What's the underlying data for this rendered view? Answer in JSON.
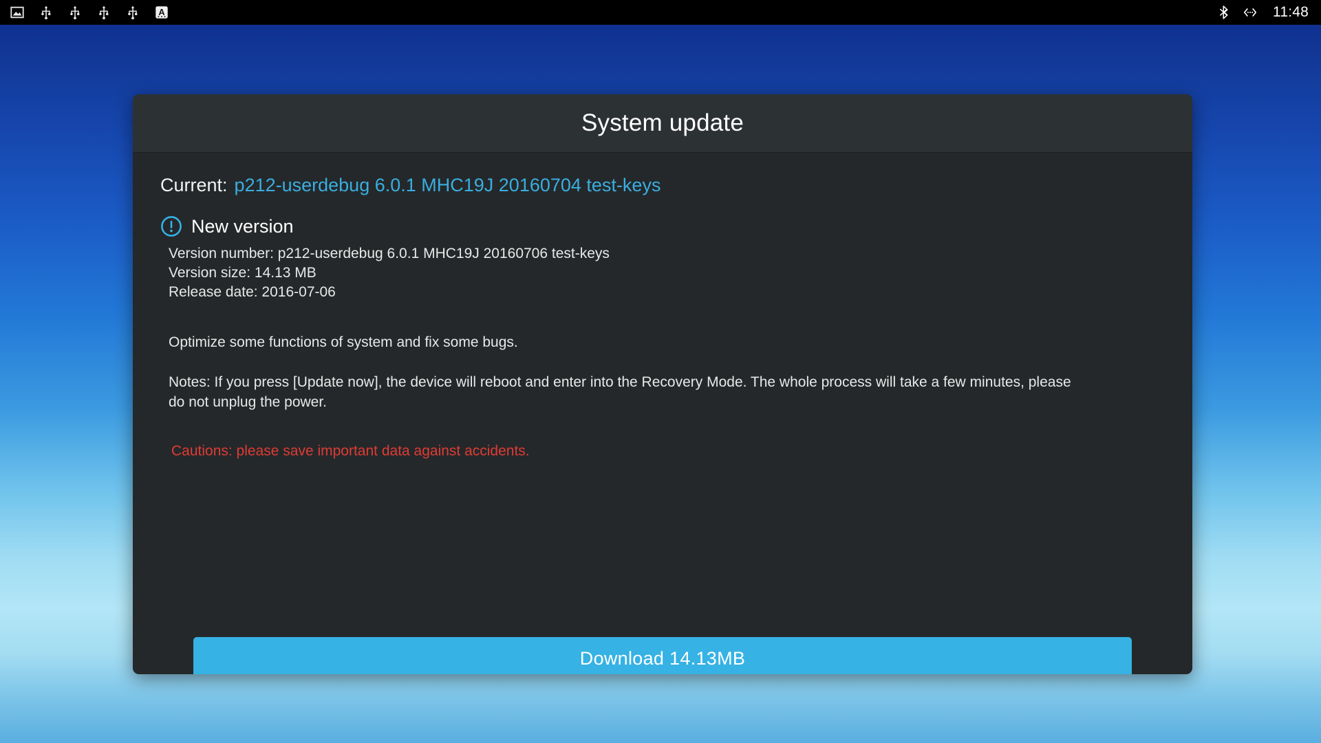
{
  "statusbar": {
    "left_icons": [
      {
        "name": "screenshot-icon",
        "label": "screenshot"
      },
      {
        "name": "usb-icon",
        "label": "usb"
      },
      {
        "name": "usb-icon",
        "label": "usb"
      },
      {
        "name": "usb-icon",
        "label": "usb"
      },
      {
        "name": "usb-icon",
        "label": "usb"
      },
      {
        "name": "input-method-icon",
        "label": "A"
      }
    ],
    "right_icons": [
      {
        "name": "bluetooth-icon",
        "label": "bluetooth"
      },
      {
        "name": "ethernet-icon",
        "label": "ethernet"
      }
    ],
    "clock": "11:48",
    "background_color": "#000000",
    "foreground_color": "#ffffff"
  },
  "dialog": {
    "title": "System update",
    "current": {
      "label": "Current:",
      "value": "p212-userdebug 6.0.1 MHC19J 20160704 test-keys",
      "value_color": "#3aaee0"
    },
    "new_version": {
      "icon": "alert-circle-icon",
      "icon_color": "#36b2e4",
      "heading": "New version",
      "version_number": "Version number: p212-userdebug 6.0.1 MHC19J 20160706 test-keys",
      "version_size": "Version size: 14.13 MB",
      "release_date": "Release date: 2016-07-06"
    },
    "description": "Optimize some functions of system and fix some bugs.",
    "notes": "Notes: If you press [Update now], the device will reboot and enter into the Recovery Mode. The whole process will take a few minutes, please do not unplug the power.",
    "caution": "Cautions: please save important data against accidents.",
    "caution_color": "#e03b35",
    "download_button": "Download  14.13MB",
    "download_button_color": "#36b2e4",
    "title_bar_color": "#2c3134",
    "body_color": "#24282a"
  },
  "desktop": {
    "gradient_top": "#0c2b8c",
    "gradient_mid": "#b3e6f6",
    "gradient_bottom": "#5aaee0"
  }
}
